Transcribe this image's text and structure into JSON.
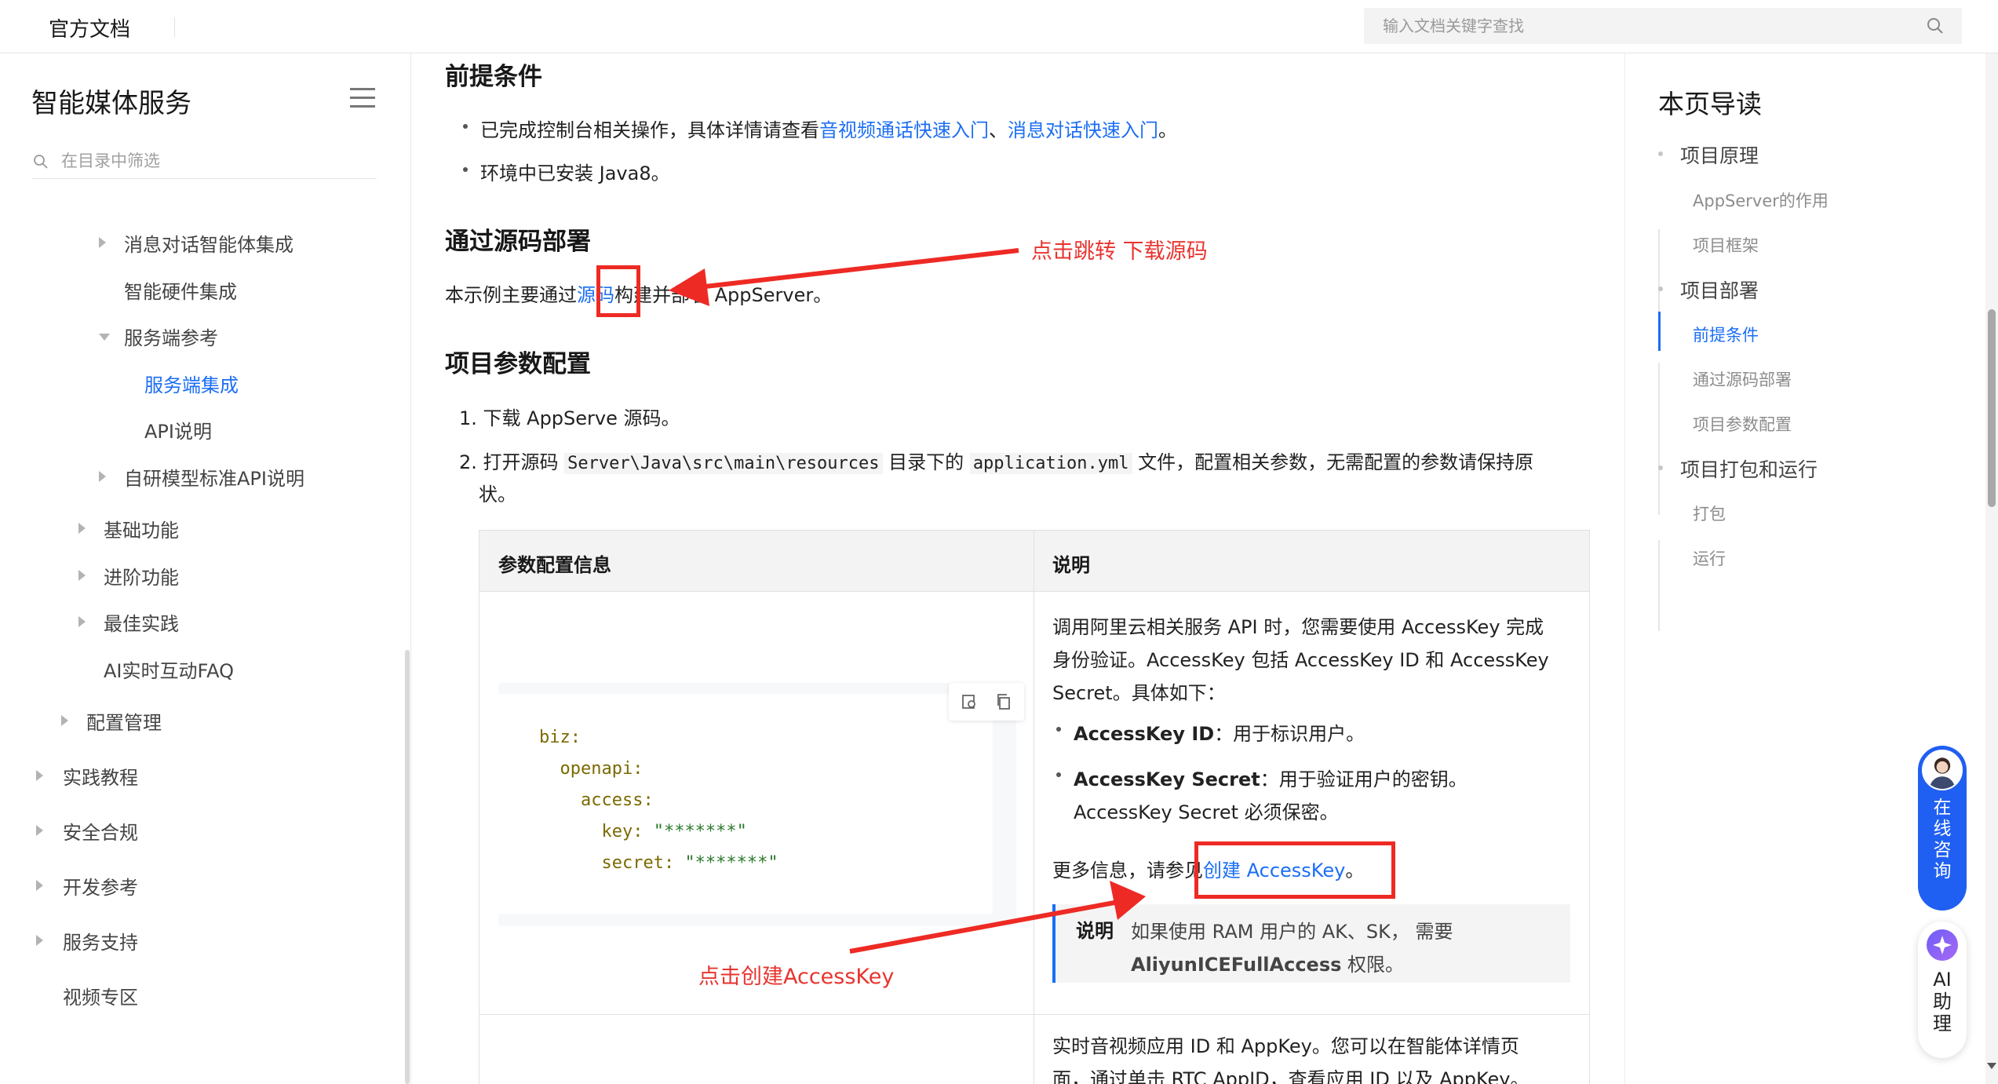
{
  "topbar": {
    "brand": "官方文档",
    "search_placeholder": "输入文档关键字查找"
  },
  "sidebar": {
    "title": "智能媒体服务",
    "filter_placeholder": "在目录中筛选",
    "items": [
      {
        "label": "消息对话智能体集成"
      },
      {
        "label": "智能硬件集成"
      },
      {
        "label": "服务端参考"
      },
      {
        "label": "服务端集成"
      },
      {
        "label": "API说明"
      },
      {
        "label": "自研模型标准API说明"
      },
      {
        "label": "基础功能"
      },
      {
        "label": "进阶功能"
      },
      {
        "label": "最佳实践"
      },
      {
        "label": "AI实时互动FAQ"
      },
      {
        "label": "配置管理"
      },
      {
        "label": "实践教程"
      },
      {
        "label": "安全合规"
      },
      {
        "label": "开发参考"
      },
      {
        "label": "服务支持"
      },
      {
        "label": "视频专区"
      }
    ]
  },
  "main": {
    "prereq": {
      "heading": "前提条件",
      "line1_prefix": "已完成控制台相关操作，具体详情请查看",
      "link1": "音视频通话快速入门",
      "sep": "、",
      "link2": "消息对话快速入门",
      "line1_suffix": "。",
      "line2": "环境中已安装 Java8。"
    },
    "deploy": {
      "heading": "通过源码部署",
      "prefix": "本示例主要通过",
      "link": "源码",
      "suffix": "构建并部署 AppServer。"
    },
    "config": {
      "heading": "项目参数配置",
      "step1": "1. 下载 AppServe 源码。",
      "step2_prefix": "2. 打开源码",
      "step2_path": "Server\\Java\\src\\main\\resources",
      "step2_mid": "目录下的",
      "step2_file": "application.yml",
      "step2_suffix": "文件，配置相关参数，无需配置的参数请保持原",
      "step2_cont": "状。"
    },
    "table": {
      "col1": "参数配置信息",
      "col2": "说明",
      "code_lines": [
        {
          "key": "biz:",
          "val": ""
        },
        {
          "key": "  openapi:",
          "val": ""
        },
        {
          "key": "    access:",
          "val": ""
        },
        {
          "key": "      key: ",
          "val": "\"*******\""
        },
        {
          "key": "      secret: ",
          "val": "\"*******\""
        }
      ],
      "desc_l1": "调用阿里云相关服务 API 时，您需要使用 AccessKey 完成",
      "desc_l2": "身份验证。AccessKey 包括 AccessKey ID 和 AccessKey",
      "desc_l3": "Secret。具体如下：",
      "ak_id_label": "AccessKey ID",
      "ak_id_text": "：用于标识用户。",
      "ak_secret_label": "AccessKey Secret",
      "ak_secret_text": "：用于验证用户的密钥。",
      "ak_secret_cont": "AccessKey Secret 必须保密。",
      "more_prefix": "更多信息，请参见",
      "more_link": "创建 AccessKey",
      "more_suffix": "。",
      "note_label": "说明",
      "note_l1": "如果使用 RAM 用户的 AK、SK， 需要",
      "note_l2_bold": "AliyunICEFullAccess",
      "note_l2_rest": " 权限。",
      "row2_l1": "实时音视频应用 ID 和 AppKey。您可以在智能体详情页",
      "row2_l2": "面，通过单击 RTC AppID，查看应用 ID 以及 AppKey。"
    },
    "annotations": {
      "a1": "点击跳转 下载源码",
      "a2": "点击创建AccessKey"
    }
  },
  "toc": {
    "title": "本页导读",
    "items": [
      {
        "label": "项目原理"
      },
      {
        "label": "AppServer的作用"
      },
      {
        "label": "项目框架"
      },
      {
        "label": "项目部署"
      },
      {
        "label": "前提条件"
      },
      {
        "label": "通过源码部署"
      },
      {
        "label": "项目参数配置"
      },
      {
        "label": "项目打包和运行"
      },
      {
        "label": "打包"
      },
      {
        "label": "运行"
      }
    ]
  },
  "floating": {
    "consult": "在线咨询",
    "ai": "AI助理"
  },
  "colors": {
    "accent": "#1b6ef3",
    "annotation": "#ee2a24"
  }
}
